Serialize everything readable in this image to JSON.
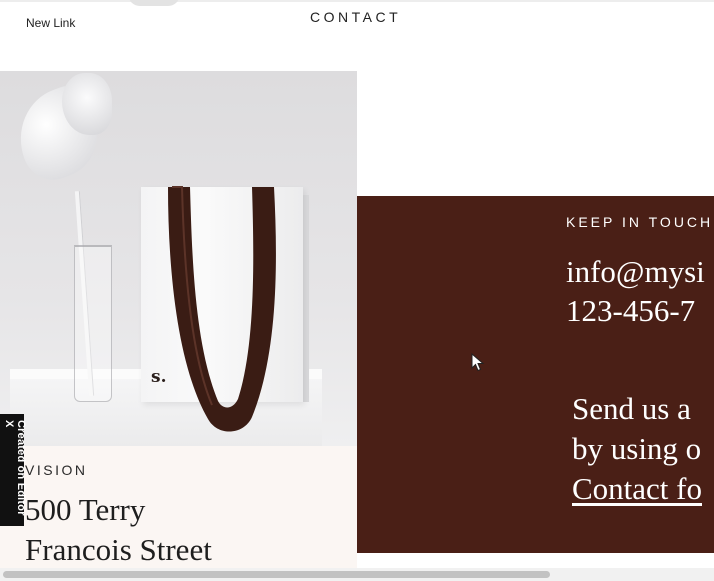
{
  "header": {
    "nav_link": "New Link",
    "page_heading": "CONTACT"
  },
  "image_panel": {
    "bag_letter": "s."
  },
  "vision_section": {
    "label": "VISION",
    "address_line_1": "500 Terry",
    "address_line_2": "Francois Street"
  },
  "keep_in_touch": {
    "label": "KEEP IN TOUCH",
    "email": "info@mysi",
    "phone": "123-456-7",
    "send_line_1": "Send us a",
    "send_line_2": "by using o",
    "contact_form_link": "Contact fo"
  },
  "badge": {
    "text": "Created on Editor X"
  },
  "colors": {
    "accent_brown": "#4a1f16",
    "vision_background": "#fbf6f3"
  },
  "icons": [
    "mouse-pointer-icon"
  ]
}
